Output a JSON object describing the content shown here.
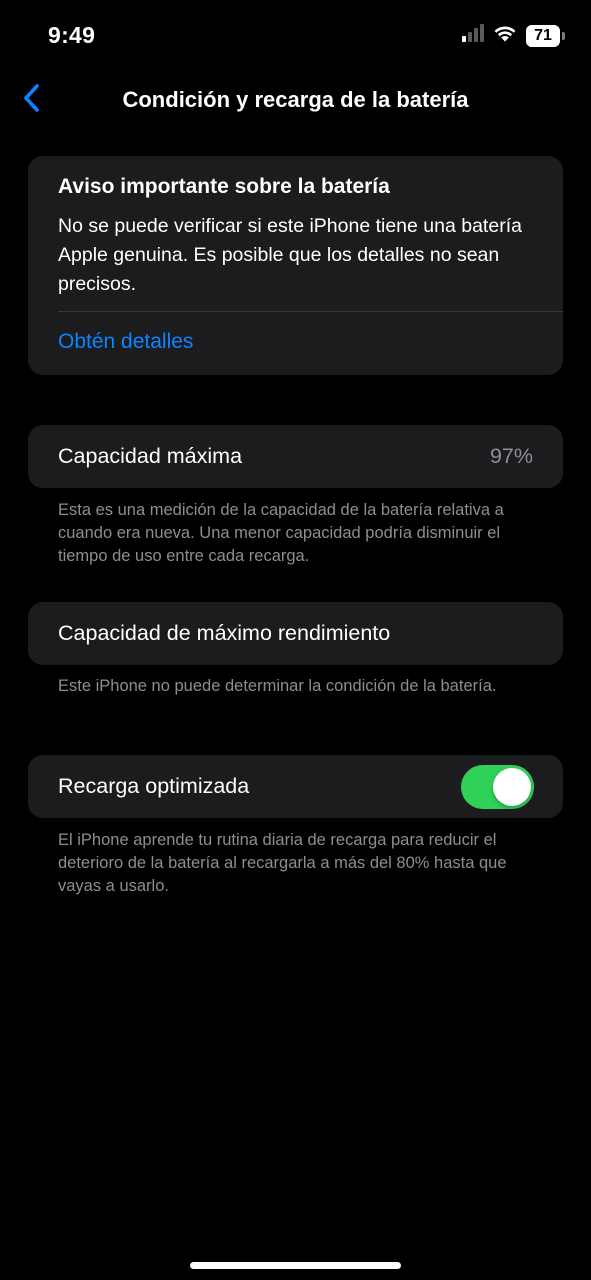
{
  "status_bar": {
    "time": "9:49",
    "signal_icon": "cellular-signal-icon",
    "wifi_icon": "wifi-icon",
    "battery_level": "71",
    "battery_fraction": 0.71
  },
  "nav": {
    "back_icon": "chevron-left-icon",
    "title": "Condición y recarga de la batería"
  },
  "notice": {
    "title": "Aviso importante sobre la batería",
    "body": "No se puede verificar si este iPhone tiene una batería Apple genuina. Es posible que los detalles no sean precisos.",
    "link": "Obtén detalles"
  },
  "capacity": {
    "label": "Capacidad máxima",
    "value": "97%",
    "note": "Esta es una medición de la capacidad de la batería relativa a cuando era nueva. Una menor capacidad podría disminuir el tiempo de uso entre cada recarga."
  },
  "performance": {
    "label": "Capacidad de máximo rendimiento",
    "note": "Este iPhone no puede determinar la condición de la batería."
  },
  "charging": {
    "label": "Recarga optimizada",
    "enabled": true,
    "note": "El iPhone aprende tu rutina diaria de recarga para reducir el deterioro de la batería al recargarla a más del 80% hasta que vayas a usarlo."
  },
  "colors": {
    "background": "#000000",
    "card": "#1c1c1e",
    "accent_blue": "#0a84ff",
    "toggle_on": "#30d158",
    "secondary_text": "#8d8d93"
  }
}
